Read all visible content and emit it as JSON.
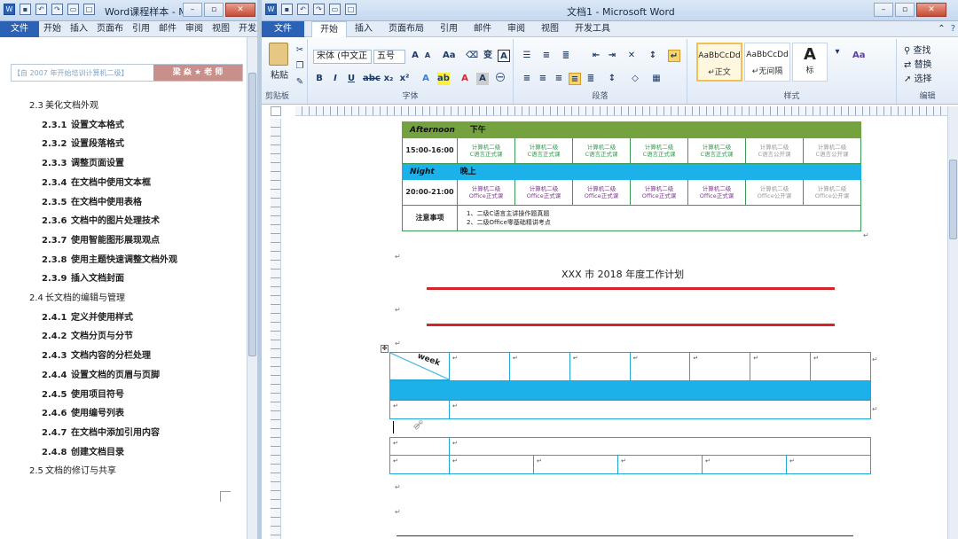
{
  "left_window": {
    "title": "Word课程样本 - M.",
    "tabs": [
      "文件",
      "开始",
      "插入",
      "页面布",
      "引用",
      "邮件",
      "审阅",
      "视图",
      "开发工"
    ],
    "banner_left": "【自 2007 年开始培训计算机二级】",
    "banner_right": "梁 焱 ★ 老 师",
    "toc": [
      {
        "num": "2.3",
        "text": "美化文档外观",
        "level": 1
      },
      {
        "num": "2.3.1",
        "text": "设置文本格式",
        "level": 2
      },
      {
        "num": "2.3.2",
        "text": "设置段落格式",
        "level": 2
      },
      {
        "num": "2.3.3",
        "text": "调整页面设置",
        "level": 2
      },
      {
        "num": "2.3.4",
        "text": "在文档中使用文本框",
        "level": 2
      },
      {
        "num": "2.3.5",
        "text": "在文档中使用表格",
        "level": 2
      },
      {
        "num": "2.3.6",
        "text": "文档中的图片处理技术",
        "level": 2
      },
      {
        "num": "2.3.7",
        "text": "使用智能图形展现观点",
        "level": 2
      },
      {
        "num": "2.3.8",
        "text": "使用主题快速调整文档外观",
        "level": 2
      },
      {
        "num": "2.3.9",
        "text": "插入文档封面",
        "level": 2
      },
      {
        "num": "2.4",
        "text": "长文档的编辑与管理",
        "level": 1
      },
      {
        "num": "2.4.1",
        "text": "定义并使用样式",
        "level": 2
      },
      {
        "num": "2.4.2",
        "text": "文档分页与分节",
        "level": 2
      },
      {
        "num": "2.4.3",
        "text": "文档内容的分栏处理",
        "level": 2
      },
      {
        "num": "2.4.4",
        "text": "设置文档的页眉与页脚",
        "level": 2
      },
      {
        "num": "2.4.5",
        "text": "使用项目符号",
        "level": 2
      },
      {
        "num": "2.4.6",
        "text": "使用编号列表",
        "level": 2
      },
      {
        "num": "2.4.7",
        "text": "在文档中添加引用内容",
        "level": 2
      },
      {
        "num": "2.4.8",
        "text": "创建文档目录",
        "level": 2
      },
      {
        "num": "2.5",
        "text": "文档的修订与共享",
        "level": 1
      }
    ]
  },
  "right_window": {
    "title": "文档1 - Microsoft Word",
    "tabs": [
      "文件",
      "开始",
      "插入",
      "页面布局",
      "引用",
      "邮件",
      "审阅",
      "视图",
      "开发工具"
    ],
    "active_tab": "开始",
    "ribbon": {
      "paste_label": "粘贴",
      "clipboard_label": "剪贴板",
      "font_name": "宋体 (中文正",
      "font_size": "五号",
      "font_group": "字体",
      "paragraph_group": "段落",
      "styles_group": "样式",
      "editing_group": "编辑",
      "styles": [
        {
          "preview": "AaBbCcDd",
          "name": "↵正文"
        },
        {
          "preview": "AaBbCcDd",
          "name": "↵无间隔"
        },
        {
          "preview": "A",
          "name": "标"
        }
      ],
      "find": "查找",
      "replace": "替换",
      "select": "选择"
    },
    "schedule": {
      "afternoon_en": "Afternoon",
      "afternoon_cn": "下午",
      "afternoon_time": "15:00-16:00",
      "afternoon_cells": [
        [
          "计算机二级",
          "C语言正式课"
        ],
        [
          "计算机二级",
          "C语言正式课"
        ],
        [
          "计算机二级",
          "C语言正式课"
        ],
        [
          "计算机二级",
          "C语言正式课"
        ],
        [
          "计算机二级",
          "C语言正式课"
        ],
        [
          "计算机二级",
          "C语言公开课"
        ],
        [
          "计算机二级",
          "C语言公开课"
        ]
      ],
      "night_en": "Night",
      "night_cn": "晚上",
      "night_time": "20:00-21:00",
      "night_cells": [
        [
          "计算机二级",
          "Office正式课"
        ],
        [
          "计算机二级",
          "Office正式课"
        ],
        [
          "计算机二级",
          "Office正式课"
        ],
        [
          "计算机二级",
          "Office正式课"
        ],
        [
          "计算机二级",
          "Office正式课"
        ],
        [
          "计算机二级",
          "Office公开课"
        ],
        [
          "计算机二级",
          "Office公开课"
        ]
      ],
      "notes_label": "注意事项",
      "notes": [
        "1、二级C语言主讲操作题真题",
        "2、二级Office零基础精讲考点"
      ]
    },
    "doc_heading": "XXX 市 2018 年度工作计划",
    "table_corner": "week",
    "colors": {
      "accent_blue": "#1cb1e8",
      "red_line": "#d6232a",
      "green_header": "#74a23f",
      "file_tab": "#2b62b5"
    }
  }
}
